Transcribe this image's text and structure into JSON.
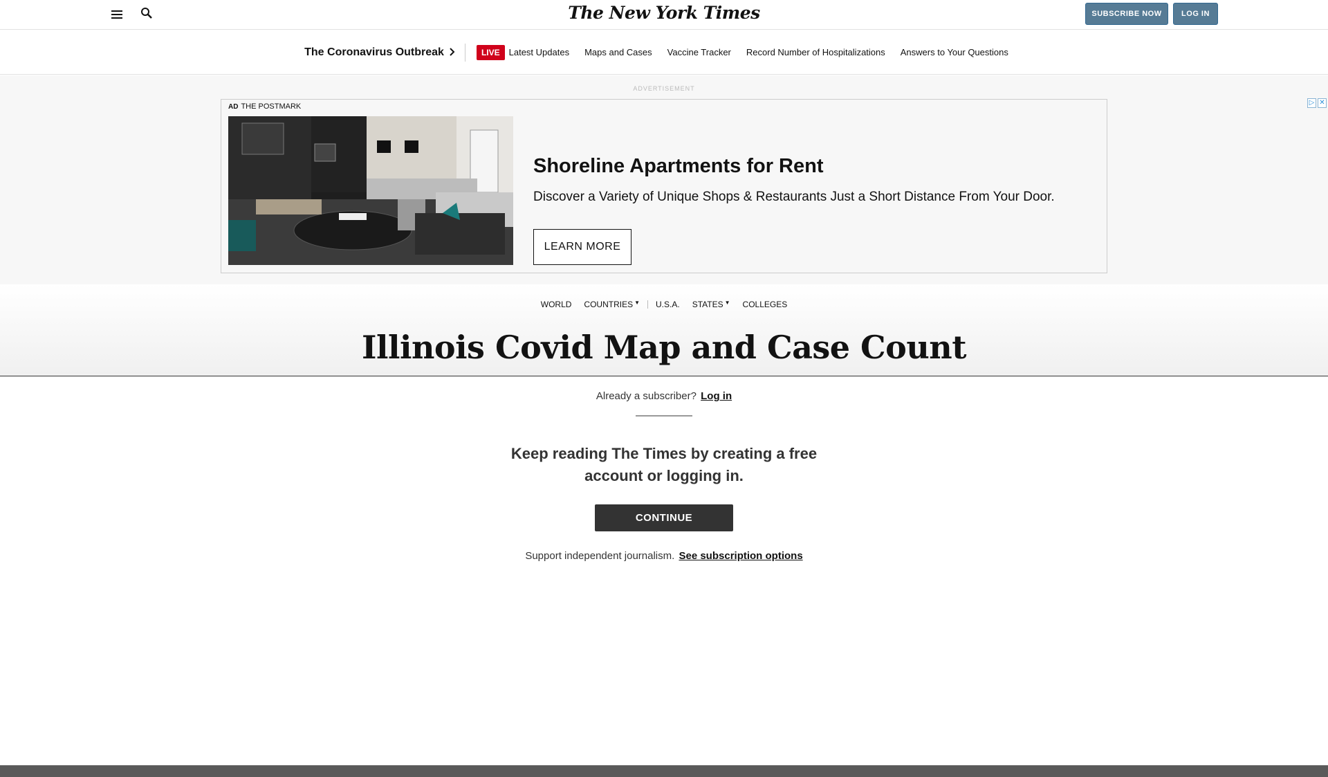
{
  "masthead": {
    "logo_text": "The New York Times",
    "subscribe_label": "SUBSCRIBE NOW",
    "login_label": "LOG IN"
  },
  "covid_nav": {
    "title": "The Coronavirus Outbreak",
    "live_badge": "LIVE",
    "links": [
      "Latest Updates",
      "Maps and Cases",
      "Vaccine Tracker",
      "Record Number of Hospitalizations",
      "Answers to Your Questions"
    ]
  },
  "ad": {
    "label": "ADVERTISEMENT",
    "tag": "AD",
    "sponsor": "THE POSTMARK",
    "title": "Shoreline Apartments for Rent",
    "description": "Discover a Variety of Unique Shops & Restaurants Just a Short Distance From Your Door.",
    "button_label": "LEARN MORE"
  },
  "section_nav": {
    "items": [
      "WORLD",
      "COUNTRIES",
      "U.S.A.",
      "STATES",
      "COLLEGES"
    ]
  },
  "headline": "Illinois Covid Map and Case Count",
  "gateway": {
    "already_text": "Already a subscriber?",
    "login_link": "Log in",
    "keep_reading": "Keep reading The Times by creating a free account or logging in.",
    "continue_label": "CONTINUE",
    "support_text": "Support independent journalism.",
    "subscription_link": "See subscription options"
  },
  "colors": {
    "subscribe_button": "#567b95",
    "live_badge": "#d0021b",
    "continue_button": "#333333"
  }
}
